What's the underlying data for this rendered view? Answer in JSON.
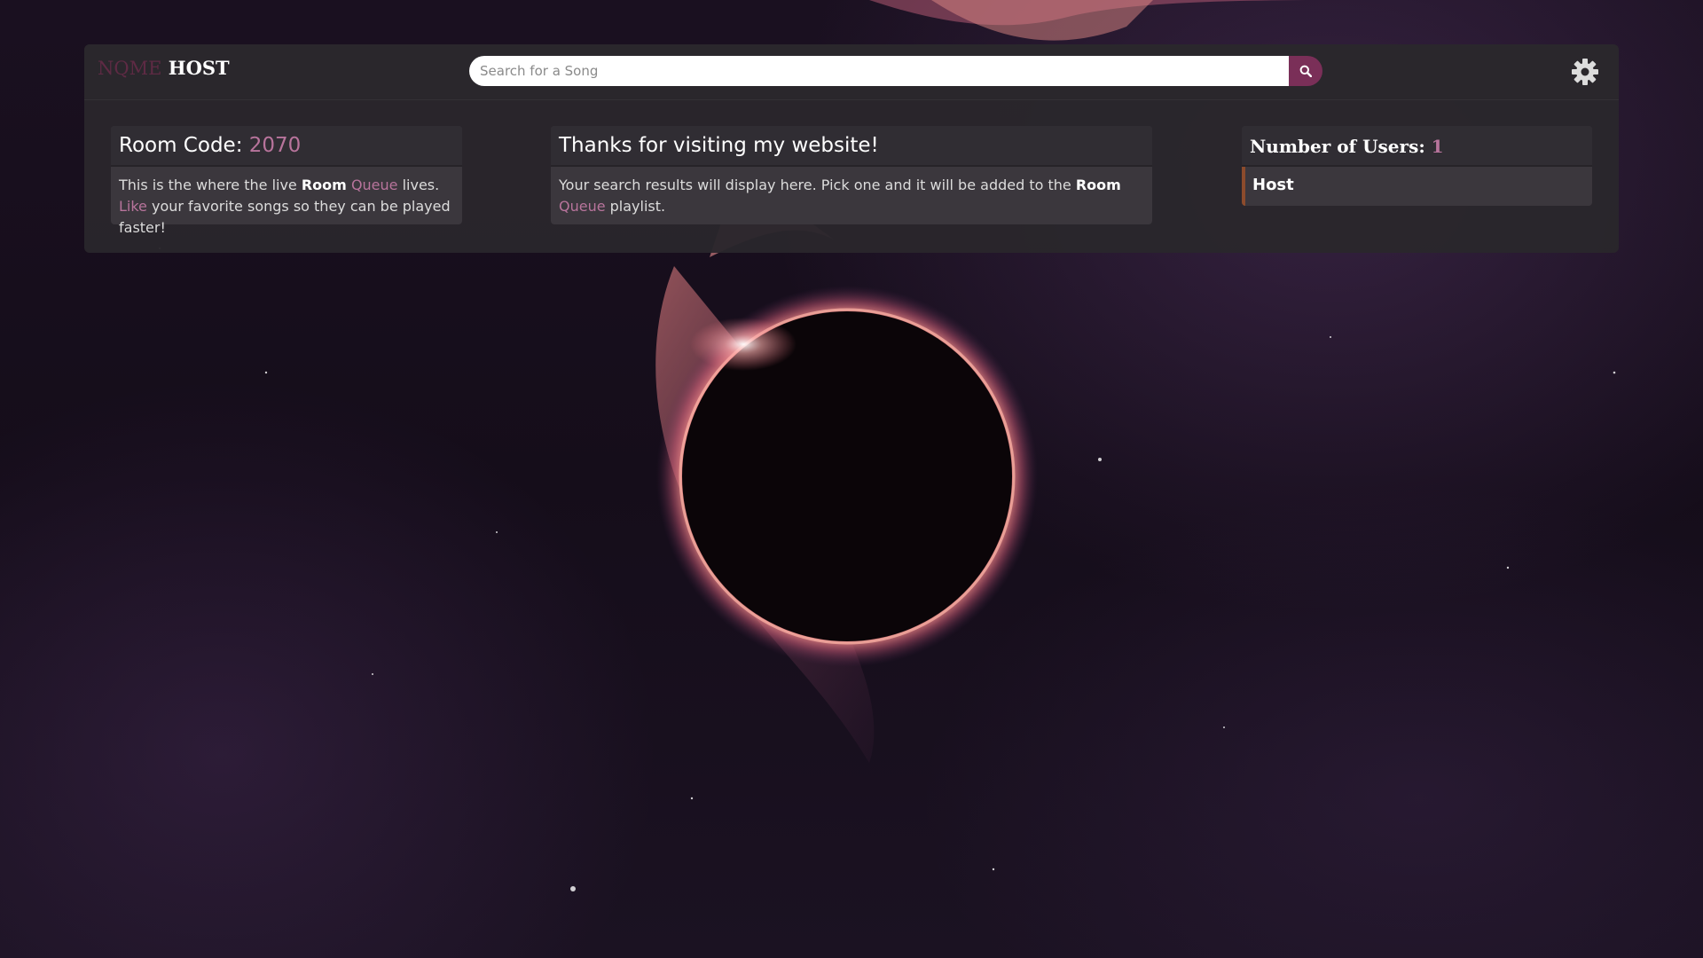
{
  "brand": {
    "part1": "NQME",
    "part2": "HOST"
  },
  "search": {
    "placeholder": "Search for a Song",
    "value": "",
    "button_icon": "search-icon"
  },
  "header": {
    "settings_icon": "gear-icon"
  },
  "room_card": {
    "title_prefix": "Room Code: ",
    "code": "2070",
    "body": {
      "t1": "This is the where the live ",
      "room": "Room",
      "queue": "Queue",
      "t2": " lives. ",
      "like": "Like",
      "t3": " your favorite songs so they can be played faster!"
    }
  },
  "info_card": {
    "title": "Thanks for visiting my website!",
    "body": {
      "t1": "Your search results will display here. Pick one and it will be added to the ",
      "room": "Room",
      "queue": "Queue",
      "t2": " playlist."
    }
  },
  "users_card": {
    "title_prefix": "Number of Users: ",
    "count": "1",
    "users": [
      "Host"
    ]
  },
  "colors": {
    "accent": "#b8749c",
    "brand_dim": "#5e2a44",
    "search_button": "#7a2f58",
    "panel": "#2a272c",
    "card": "#3b373d",
    "user_border": "#8c4b2c"
  }
}
